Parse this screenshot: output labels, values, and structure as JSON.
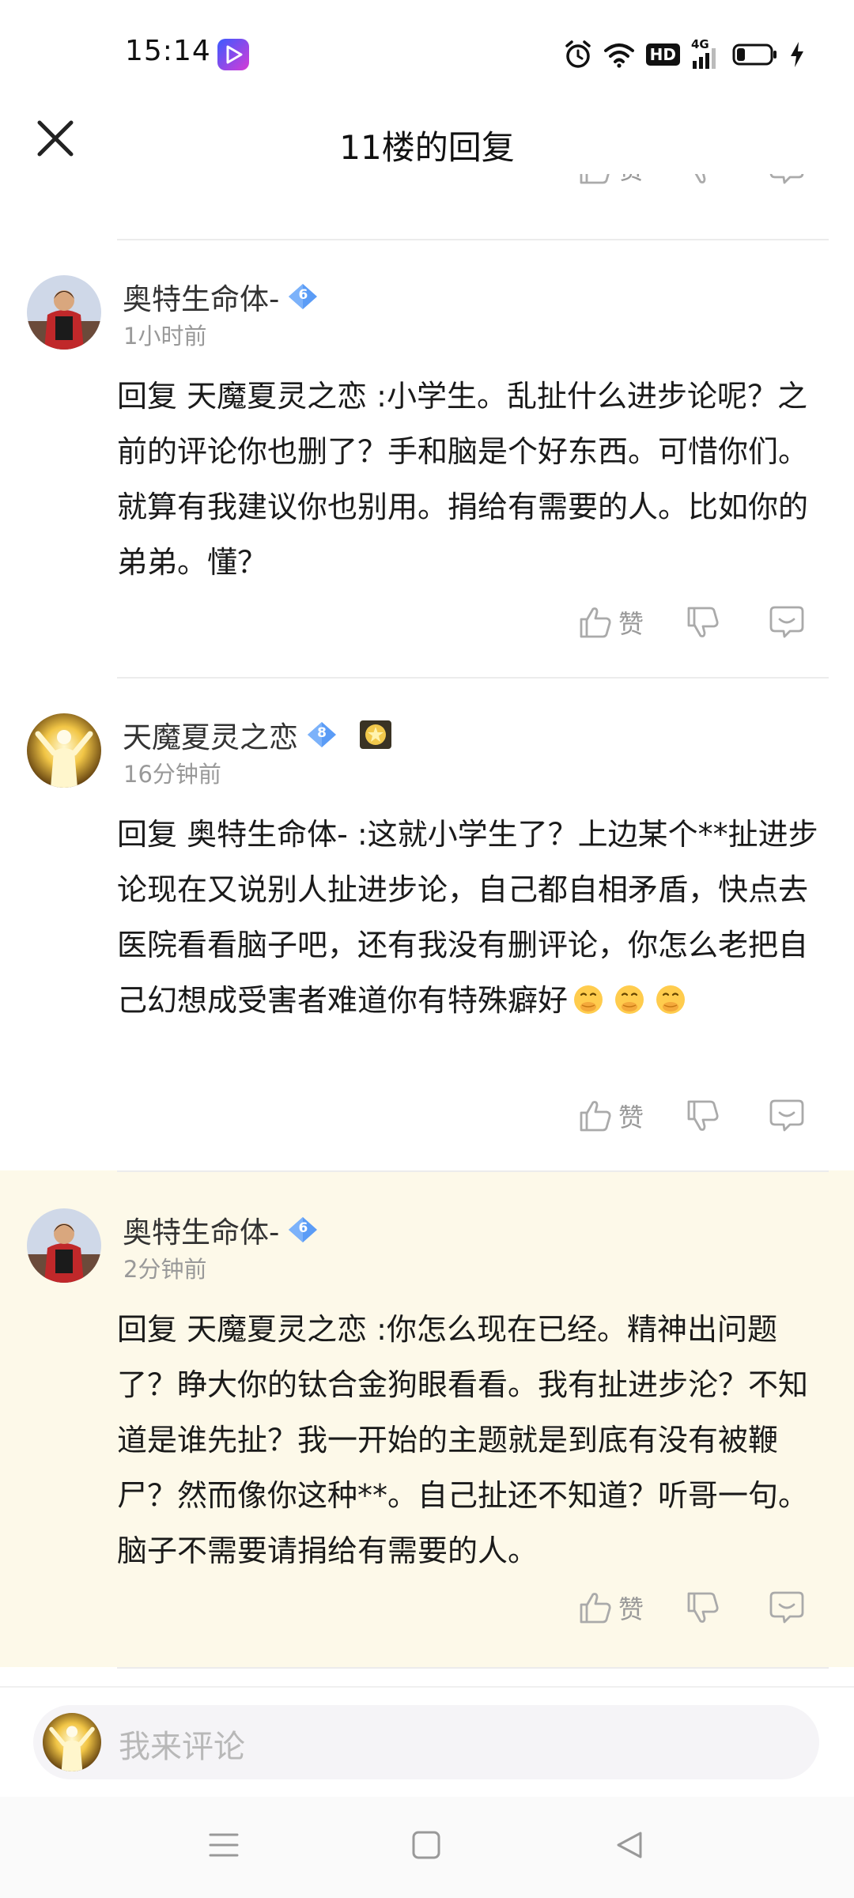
{
  "status_bar": {
    "time": "15:14",
    "hd_label": "HD",
    "network_label": "4G"
  },
  "header": {
    "title": "11楼的回复"
  },
  "comments": [
    {
      "username": "奥特生命体-",
      "level": "6",
      "time": "1小时前",
      "text": "回复 天魔夏灵之恋 :小学生。乱扯什么进步论呢？之前的评论你也删了？手和脑是个好东西。可惜你们。就算有我建议你也别用。捐给有需要的人。比如你的弟弟。懂？",
      "like_label": "赞"
    },
    {
      "username": "天魔夏灵之恋",
      "level": "8",
      "time": "16分钟前",
      "text": "回复 奥特生命体- :这就小学生了？上边某个**扯进步论现在又说别人扯进步论，自己都自相矛盾，快点去医院看看脑子吧，还有我没有删评论，你怎么老把自己幻想成受害者难道你有特殊癖好",
      "like_label": "赞"
    },
    {
      "username": "奥特生命体-",
      "level": "6",
      "time": "2分钟前",
      "text": "回复 天魔夏灵之恋 :你怎么现在已经。精神出问题了？睁大你的钛合金狗眼看看。我有扯进步沦？不知道是谁先扯？我一开始的主题就是到底有没有被鞭尸？然而像你这种**。自己扯还不知道？听哥一句。脑子不需要请捐给有需要的人。",
      "like_label": "赞"
    }
  ],
  "partial_like_label": "赞",
  "input": {
    "placeholder": "我来评论"
  },
  "icons": {
    "close": "close-icon",
    "like": "thumbs-up-icon",
    "dislike": "thumbs-down-icon",
    "reply": "comment-bubble-icon",
    "nav_menu": "menu-icon",
    "nav_home": "home-square-icon",
    "nav_back": "back-triangle-icon"
  },
  "colors": {
    "highlight_bg": "#fdf9e9",
    "badge_blue": "#5b9cf6",
    "secondary_text": "#999999"
  }
}
